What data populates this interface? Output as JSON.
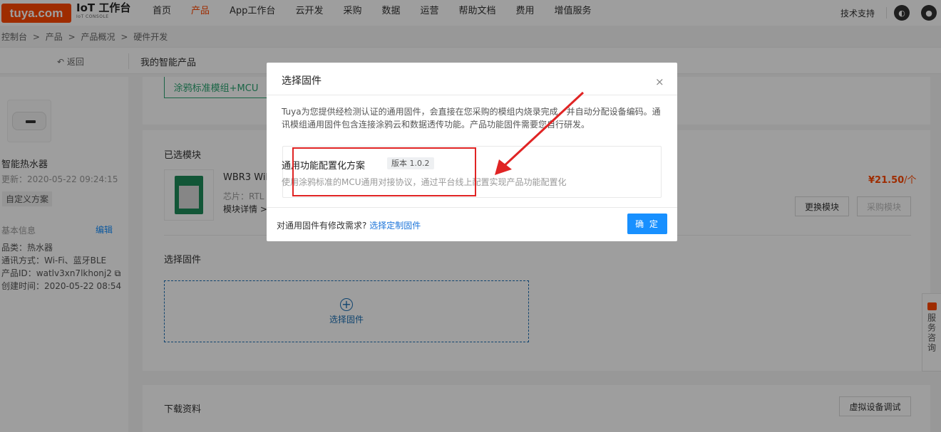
{
  "topnav": {
    "logo": "tuya.com",
    "brand_title": "IoT 工作台",
    "brand_sub": "IoT CONSOLE",
    "menu": [
      "首页",
      "产品",
      "App工作台",
      "云开发",
      "采购",
      "数据",
      "运营",
      "帮助文档",
      "费用",
      "增值服务"
    ],
    "active_index": 1,
    "support": "技术支持"
  },
  "breadcrumb": [
    "控制台",
    ">",
    "产品",
    ">",
    "产品概况",
    ">",
    "硬件开发"
  ],
  "subheader": {
    "back": "返回",
    "title": "我的智能产品"
  },
  "left": {
    "product_name": "智能热水器",
    "updated": "更新：2020-05-22 09:24:15",
    "tag": "自定义方案",
    "basic_info": "基本信息",
    "edit": "编辑",
    "rows": [
      "品类：热水器",
      "通讯方式：Wi-Fi、蓝牙BLE",
      "产品ID：watlv3xn7lkhonj2",
      "创建时间：2020-05-22 08:54"
    ]
  },
  "main": {
    "tab": "涂鸦标准模组+MCU",
    "selected_module_title": "已选模块",
    "module_name": "WBR3 WiF",
    "module_chip": "芯片：RTL",
    "module_detail": "模块详情 >",
    "price": "¥21.50",
    "price_unit": "/个",
    "btn_replace": "更换模块",
    "btn_buy": "采购模块",
    "select_fw_title": "选择固件",
    "select_fw_box": "选择固件",
    "download_title": "下载资料",
    "btn_virtual": "虚拟设备调试"
  },
  "float": {
    "consult": "服务咨询"
  },
  "modal": {
    "title": "选择固件",
    "close": "×",
    "desc": "Tuya为您提供经检测认证的通用固件，会直接在您采购的模组内烧录完成，并自动分配设备编码。通讯模组通用固件包含连接涂鸦云和数据透传功能。产品功能固件需要您自行研发。",
    "fw_name": "通用功能配置化方案",
    "fw_version": "版本 1.0.2",
    "fw_desc": "使用涂鸦标准的MCU通用对接协议，通过平台线上配置实现产品功能配置化",
    "footer_q": "对通用固件有修改需求?",
    "footer_link": "选择定制固件",
    "ok": "确 定"
  },
  "colors": {
    "brand": "#ff4800",
    "primary": "#1890ff",
    "annotation": "#e02424"
  }
}
